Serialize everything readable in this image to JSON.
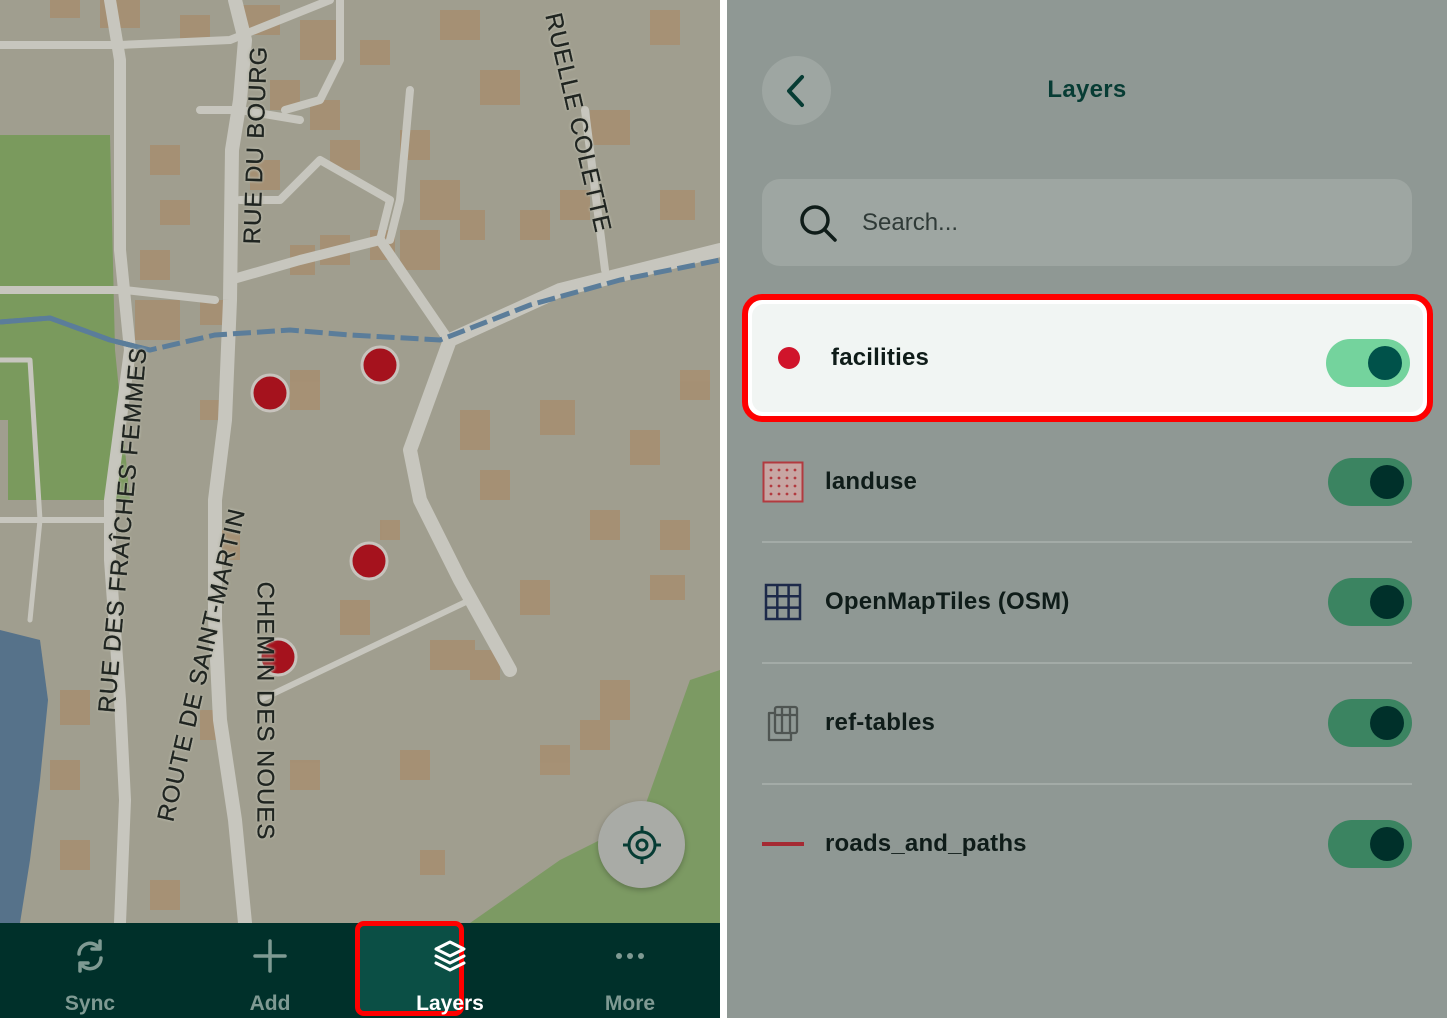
{
  "map": {
    "street_labels": [
      "RUE DU BOURG",
      "RUELLE COLETTE",
      "RUE DES FRAÎCHES FEMMES",
      "ROUTE DE SAINT-MARTIN",
      "CHEMIN DES NOUES"
    ],
    "marker_color": "#b0151f",
    "locate_icon": "crosshair-icon"
  },
  "bottom_nav": {
    "items": [
      {
        "label": "Sync",
        "icon": "sync-icon"
      },
      {
        "label": "Add",
        "icon": "plus-icon"
      },
      {
        "label": "Layers",
        "icon": "layers-icon"
      },
      {
        "label": "More",
        "icon": "more-icon"
      }
    ],
    "active": "Layers"
  },
  "layers_panel": {
    "title": "Layers",
    "back_icon": "chevron-left-icon",
    "search": {
      "placeholder": "Search...",
      "value": "",
      "icon": "search-icon"
    },
    "layers": [
      {
        "name": "facilities",
        "icon": "point-layer-icon",
        "enabled": true,
        "highlighted": true
      },
      {
        "name": "landuse",
        "icon": "polygon-layer-icon",
        "enabled": true
      },
      {
        "name": "OpenMapTiles (OSM)",
        "icon": "grid-tiles-icon",
        "enabled": true
      },
      {
        "name": "ref-tables",
        "icon": "table-copy-icon",
        "enabled": true
      },
      {
        "name": "roads_and_paths",
        "icon": "line-layer-icon",
        "enabled": true
      }
    ]
  },
  "colors": {
    "accent_dark": "#00302a",
    "toggle_on": "#3b8461",
    "toggle_on_highlight": "#74d39d",
    "highlight_border": "#ff0000",
    "point_color": "#d0142b"
  }
}
